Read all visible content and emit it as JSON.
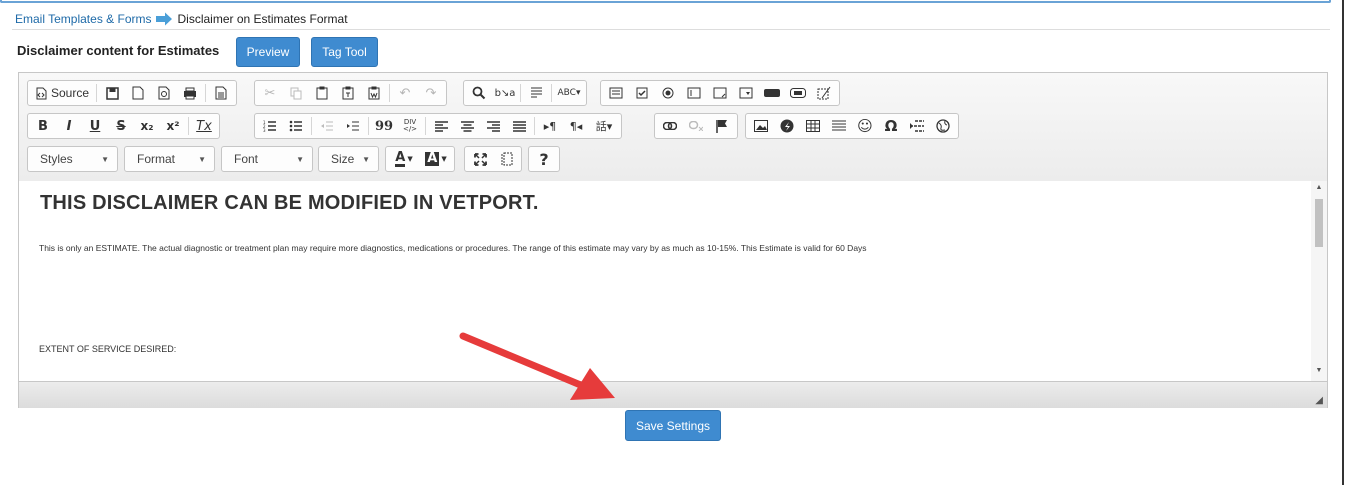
{
  "breadcrumb": {
    "parent": "Email Templates & Forms",
    "current": "Disclaimer on Estimates Format"
  },
  "heading": "Disclaimer content for Estimates",
  "buttons": {
    "preview": "Preview",
    "tag_tool": "Tag Tool",
    "save": "Save Settings"
  },
  "toolbar": {
    "source_label": "Source",
    "combos": {
      "styles": "Styles",
      "format": "Format",
      "font": "Font",
      "size": "Size"
    },
    "glyphs": {
      "bold": "B",
      "italic": "I",
      "underline": "U",
      "strike": "S",
      "blockquote": "99",
      "special_char": "Ω",
      "help": "?",
      "text_color": "A",
      "bg_color": "A"
    }
  },
  "content": {
    "title": "THIS DISCLAIMER CAN BE MODIFIED IN VETPORT.",
    "paragraph": "This is only an ESTIMATE. The actual diagnostic or treatment plan may require more diagnostics, medications or procedures. The range of this estimate may vary by as much as 10-15%. This Estimate is valid for 60 Days",
    "extent": "EXTENT OF SERVICE DESIRED:"
  },
  "colors": {
    "accent": "#3f8bd0",
    "link": "#1e6aa8",
    "annotation_arrow": "#e63b3b"
  }
}
